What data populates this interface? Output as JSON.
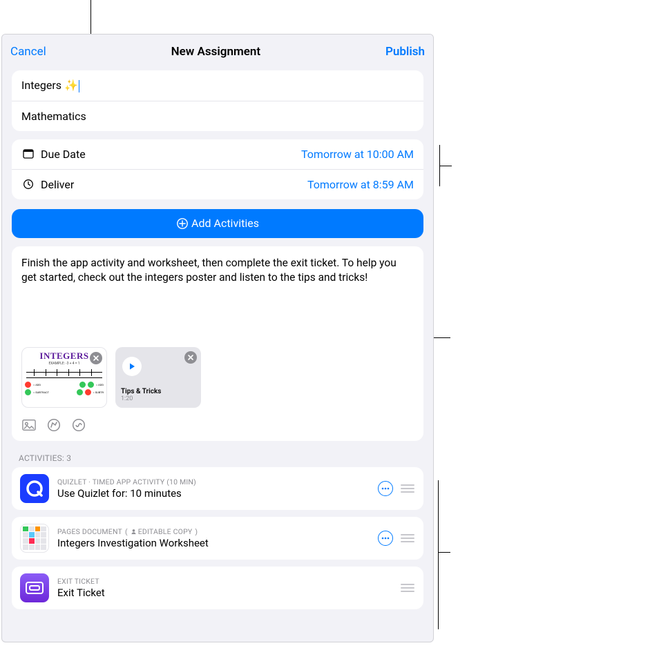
{
  "titlebar": {
    "cancel": "Cancel",
    "title": "New Assignment",
    "publish": "Publish"
  },
  "fields": {
    "name": "Integers ✨",
    "class": "Mathematics"
  },
  "dates": {
    "due_label": "Due Date",
    "due_value": "Tomorrow at 10:00 AM",
    "deliver_label": "Deliver",
    "deliver_value": "Tomorrow at 8:59 AM"
  },
  "add_activities": "Add Activities",
  "instructions": "Finish the app activity and worksheet, then complete the exit ticket. To help you get started, check out the integers poster and listen to the tips and tricks!",
  "attachments": {
    "poster": {
      "title": "INTEGERS",
      "example": "EXAMPLE: -3 + 4 = 1"
    },
    "audio": {
      "title": "Tips & Tricks",
      "duration": "1:20"
    }
  },
  "activities_header": "ACTIVITIES: 3",
  "activities": [
    {
      "meta1": "QUIZLET · TIMED APP ACTIVITY (10 MIN)",
      "title": "Use Quizlet for: 10 minutes",
      "has_more": true
    },
    {
      "meta1": "PAGES DOCUMENT",
      "meta_badge": "EDITABLE COPY",
      "title": "Integers Investigation Worksheet",
      "has_more": true
    },
    {
      "meta1": "EXIT TICKET",
      "title": "Exit Ticket",
      "has_more": false
    }
  ]
}
